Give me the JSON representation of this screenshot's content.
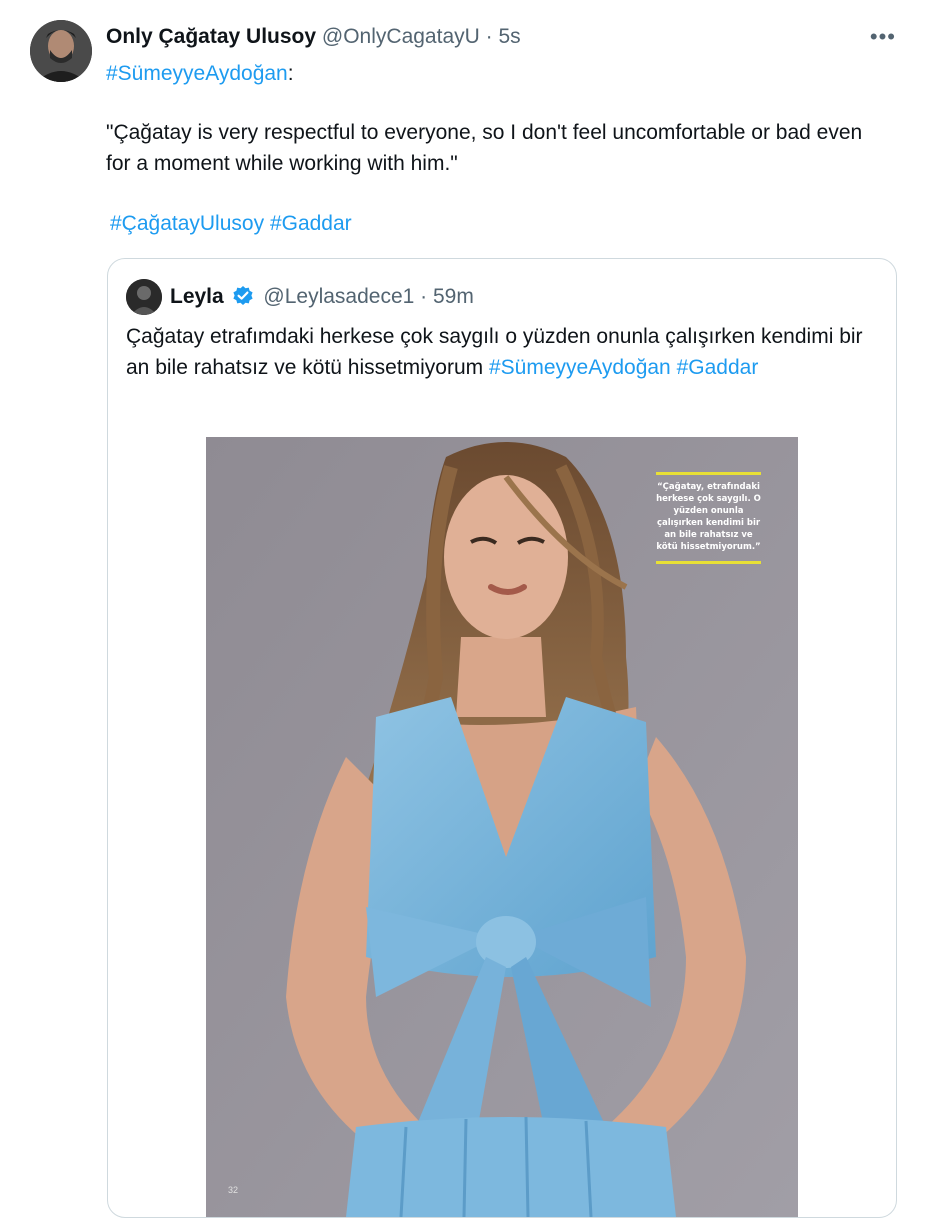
{
  "tweet": {
    "author_name": "Only Çağatay Ulusoy",
    "author_handle": "@OnlyCagatayU",
    "dot": "·",
    "time": "5s",
    "more_label": "•••",
    "mention_tag": "#SümeyyeAydoğan",
    "mention_suffix": ":",
    "quote": "\"Çağatay is very respectful to everyone, so I don't feel uncomfortable or bad even for a moment while working with him.\"",
    "tag_1": "#ÇağatayUlusoy",
    "tag_2": "#Gaddar"
  },
  "quoted": {
    "author_name": "Leyla",
    "author_handle": "@Leylasadece1",
    "dot": "·",
    "time": "59m",
    "text": "Çağatay etrafımdaki herkese çok saygılı o yüzden onunla çalışırken kendimi bir an bile rahatsız ve kötü hissetmiyorum",
    "tag_1": "#SümeyyeAydoğan",
    "tag_2": "#Gaddar",
    "verified_color": "#1d9bf0"
  },
  "photo": {
    "pull_quote": "“Çağatay, etrafındaki herkese çok saygılı. O yüzden onunla çalışırken kendimi bir an bile rahatsız ve kötü hissetmiyorum.”",
    "page_number": "32",
    "accent_color": "#e8e035"
  },
  "colors": {
    "link": "#1d9bf0",
    "muted": "#536471",
    "text": "#0f1419"
  }
}
